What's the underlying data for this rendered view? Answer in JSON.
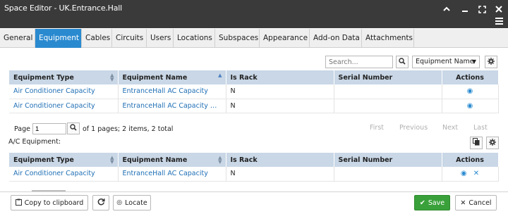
{
  "window": {
    "title": "Space Editor - UK.Entrance.Hall",
    "icons": [
      "chevron-up-icon",
      "window-minimize-icon",
      "maximize-icon",
      "close-icon",
      "hamburger-menu-icon"
    ]
  },
  "tabs": [
    {
      "label": "General"
    },
    {
      "label": "Equipment"
    },
    {
      "label": "Cables"
    },
    {
      "label": "Circuits"
    },
    {
      "label": "Users"
    },
    {
      "label": "Locations"
    },
    {
      "label": "Subspaces"
    },
    {
      "label": "Appearance"
    },
    {
      "label": "Add-on Data"
    },
    {
      "label": "Attachments"
    }
  ],
  "search": {
    "placeholder": "Search...",
    "field_select": "Equipment Name"
  },
  "equipment_table": {
    "columns": [
      "Equipment Type",
      "Equipment Name",
      "Is Rack",
      "Serial Number",
      "Actions"
    ],
    "rows": [
      {
        "type": "Air Conditioner Capacity",
        "name": "EntranceHall AC Capacity",
        "is_rack": "N",
        "serial": ""
      },
      {
        "type": "Air Conditioner Capacity",
        "name": "EntranceHall AC Capacity Co...",
        "is_rack": "N",
        "serial": ""
      }
    ]
  },
  "pager": {
    "page_label": "Page",
    "page_value": "1",
    "summary": "of 1 pages; 2 items, 2 total",
    "first": "First",
    "previous": "Previous",
    "next": "Next",
    "last": "Last"
  },
  "ac_section": {
    "label": "A/C Equipment:",
    "columns": [
      "Equipment Type",
      "Equipment Name",
      "Is Rack",
      "Serial Number",
      "Actions"
    ],
    "rows": [
      {
        "type": "Air Conditioner Capacity",
        "name": "EntranceHall AC Capacity",
        "is_rack": "N",
        "serial": ""
      }
    ]
  },
  "footer": {
    "copy_label": "Copy to clipboard",
    "locate_label": "Locate",
    "save_label": "Save",
    "cancel_label": "Cancel"
  },
  "colors": {
    "titlebar": "#3a3a3a",
    "active_tab": "#2a8ad0",
    "header_row": "#c9d7e6",
    "link": "#1f6fb5",
    "save": "#3aa13a"
  }
}
